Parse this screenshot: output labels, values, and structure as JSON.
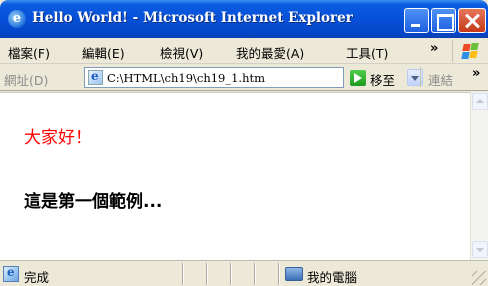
{
  "window": {
    "title": "Hello World! - Microsoft Internet Explorer"
  },
  "menu": {
    "items": [
      {
        "label": "檔案(F)"
      },
      {
        "label": "編輯(E)"
      },
      {
        "label": "檢視(V)"
      },
      {
        "label": "我的最愛(A)"
      },
      {
        "label": "工具(T)"
      }
    ],
    "overflow": "»"
  },
  "address": {
    "label": "網址(D)",
    "value": "C:\\HTML\\ch19\\ch19_1.htm",
    "go_label": "移至",
    "links_label": "連結",
    "links_overflow": "»"
  },
  "page": {
    "greeting": "大家好！",
    "heading": "這是第一個範例..."
  },
  "status": {
    "text": "完成",
    "zone": "我的電腦"
  },
  "colors": {
    "greeting": "#ff0000",
    "title_bar": "#0650d8"
  }
}
